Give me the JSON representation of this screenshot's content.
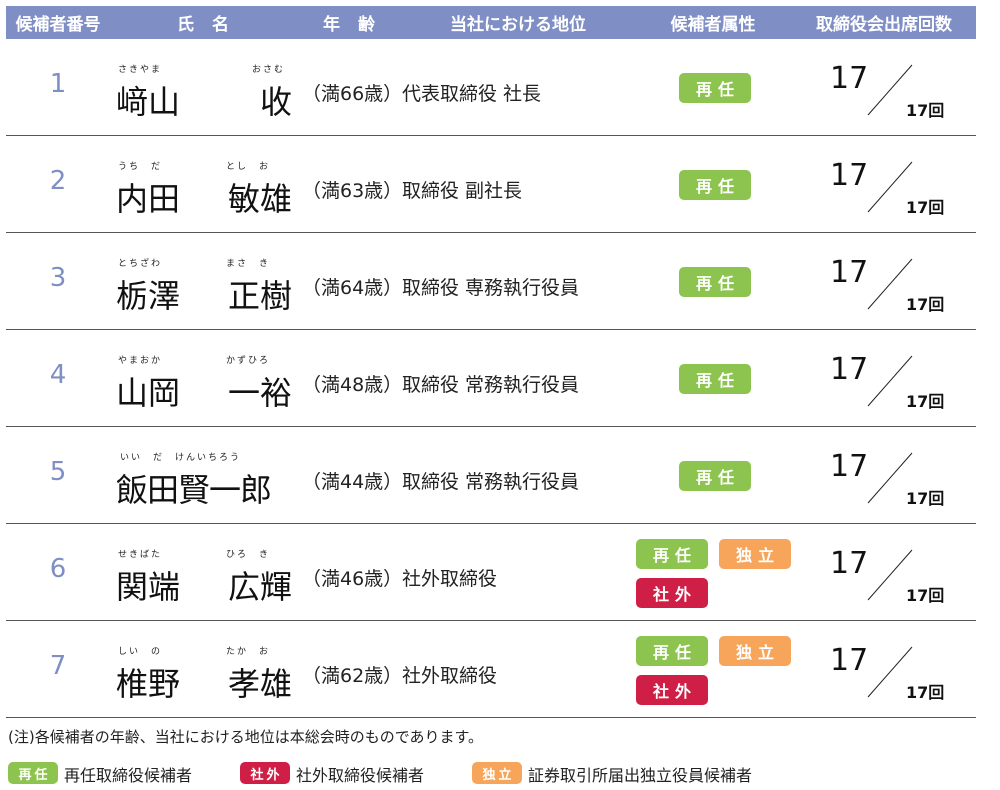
{
  "header": {
    "no": "候補者番号",
    "name": "氏名",
    "age": "年齢",
    "position": "当社における地位",
    "attribute": "候補者属性",
    "attendance": "取締役会出席回数"
  },
  "badges": {
    "reelect": "再任",
    "independent": "独立",
    "outside": "社外"
  },
  "candidates": [
    {
      "no": "1",
      "last": "﨑山",
      "first": "收",
      "last_kana": "さきやま",
      "first_kana": "おさむ",
      "age": "（満66歳）",
      "position": "代表取締役 社長",
      "attended": "17",
      "total": "17回"
    },
    {
      "no": "2",
      "last": "内田",
      "first": "敏雄",
      "last_kana": "うち　だ",
      "first_kana": "とし　お",
      "age": "（満63歳）",
      "position": "取締役 副社長",
      "attended": "17",
      "total": "17回"
    },
    {
      "no": "3",
      "last": "栃澤",
      "first": "正樹",
      "last_kana": "とちざわ",
      "first_kana": "まさ　き",
      "age": "（満64歳）",
      "position": "取締役 専務執行役員",
      "attended": "17",
      "total": "17回"
    },
    {
      "no": "4",
      "last": "山岡",
      "first": "一裕",
      "last_kana": "やまおか",
      "first_kana": "かずひろ",
      "age": "（満48歳）",
      "position": "取締役 常務執行役員",
      "attended": "17",
      "total": "17回"
    },
    {
      "no": "5",
      "full": "飯田賢一郎",
      "full_kana": "いい　だ　けんいちろう",
      "age": "（満44歳）",
      "position": "取締役 常務執行役員",
      "attended": "17",
      "total": "17回"
    },
    {
      "no": "6",
      "last": "関端",
      "first": "広輝",
      "last_kana": "せきばた",
      "first_kana": "ひろ　き",
      "age": "（満46歳）",
      "position": "社外取締役",
      "attended": "17",
      "total": "17回"
    },
    {
      "no": "7",
      "last": "椎野",
      "first": "孝雄",
      "last_kana": "しい　の",
      "first_kana": "たか　お",
      "age": "（満62歳）",
      "position": "社外取締役",
      "attended": "17",
      "total": "17回"
    }
  ],
  "note": "(注)各候補者の年齢、当社における地位は本総会時のものであります。",
  "legend": {
    "reelect_desc": "再任取締役候補者",
    "outside_desc": "社外取締役候補者",
    "independent_desc": "証券取引所届出独立役員候補者"
  },
  "colors": {
    "header": "#7f8ec4",
    "reelect": "#8dc34f",
    "independent": "#f6a55a",
    "outside": "#d01f46"
  }
}
